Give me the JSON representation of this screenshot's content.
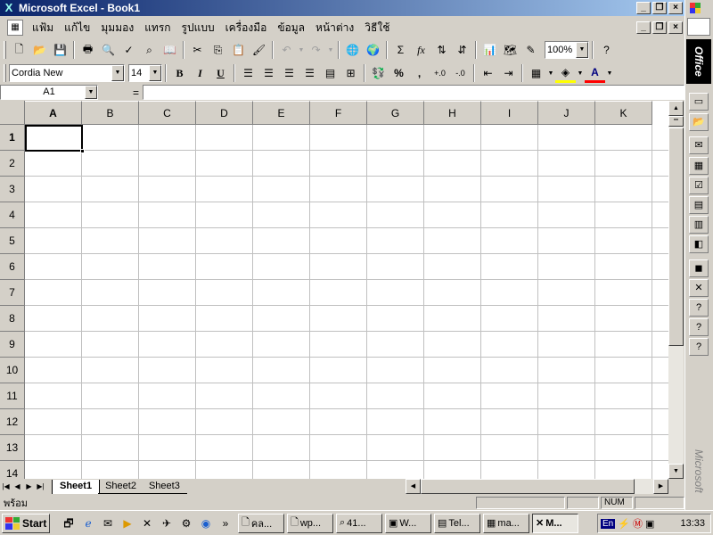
{
  "window": {
    "title": "Microsoft Excel - Book1"
  },
  "menu": {
    "items": [
      "แฟ้ม",
      "แก้ไข",
      "มุมมอง",
      "แทรก",
      "รูปแบบ",
      "เครื่องมือ",
      "ข้อมูล",
      "หน้าต่าง",
      "วิธีใช้"
    ]
  },
  "toolbar": {
    "zoom": "100%",
    "font": "Cordia New",
    "font_size": "14",
    "bold": "B",
    "italic": "I",
    "underline": "U",
    "sum": "Σ",
    "fx": "fx",
    "percent": "%",
    "comma": ","
  },
  "formula_bar": {
    "name_box": "A1",
    "equals": "="
  },
  "grid": {
    "columns": [
      "A",
      "B",
      "C",
      "D",
      "E",
      "F",
      "G",
      "H",
      "I",
      "J",
      "K"
    ],
    "rows": [
      "1",
      "2",
      "3",
      "4",
      "5",
      "6",
      "7",
      "8",
      "9",
      "10",
      "11",
      "12",
      "13",
      "14"
    ],
    "active_cell": "A1"
  },
  "sheets": [
    "Sheet1",
    "Sheet2",
    "Sheet3"
  ],
  "status": {
    "text": "พร้อม",
    "num": "NUM"
  },
  "office_bar": {
    "label": "Office",
    "brand": "Microsoft"
  },
  "taskbar": {
    "start": "Start",
    "tasks": [
      "คล...",
      "wp...",
      "41...",
      "W...",
      "Tel...",
      "ma...",
      "M..."
    ],
    "lang": "En",
    "clock": "13:33"
  },
  "colors": {
    "titlebar_start": "#0a246a",
    "titlebar_end": "#a6caf0",
    "face": "#d4d0c8"
  }
}
